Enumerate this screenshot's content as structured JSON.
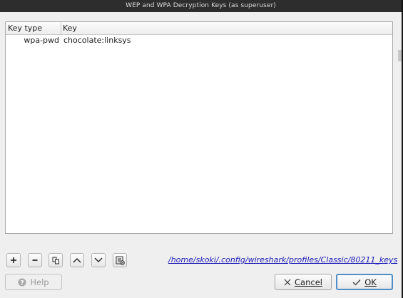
{
  "window": {
    "title": "WEP and WPA Decryption Keys (as superuser)"
  },
  "table": {
    "columns": [
      "Key type",
      "Key"
    ],
    "rows": [
      {
        "type": "wpa-pwd",
        "key": "chocolate:linksys"
      }
    ]
  },
  "toolbar": {
    "icons": [
      "add-icon",
      "remove-icon",
      "copy-icon",
      "move-up-icon",
      "move-down-icon",
      "clear-icon"
    ],
    "file_path": "/home/skoki/.config/wireshark/profiles/Classic/80211_keys"
  },
  "buttons": {
    "help_label": "Help",
    "cancel_label": "Cancel",
    "ok_label": "OK"
  },
  "colors": {
    "titlebar": "#2d2d2d",
    "link": "#1a1ab8",
    "ok_border": "#4f8dc9"
  }
}
